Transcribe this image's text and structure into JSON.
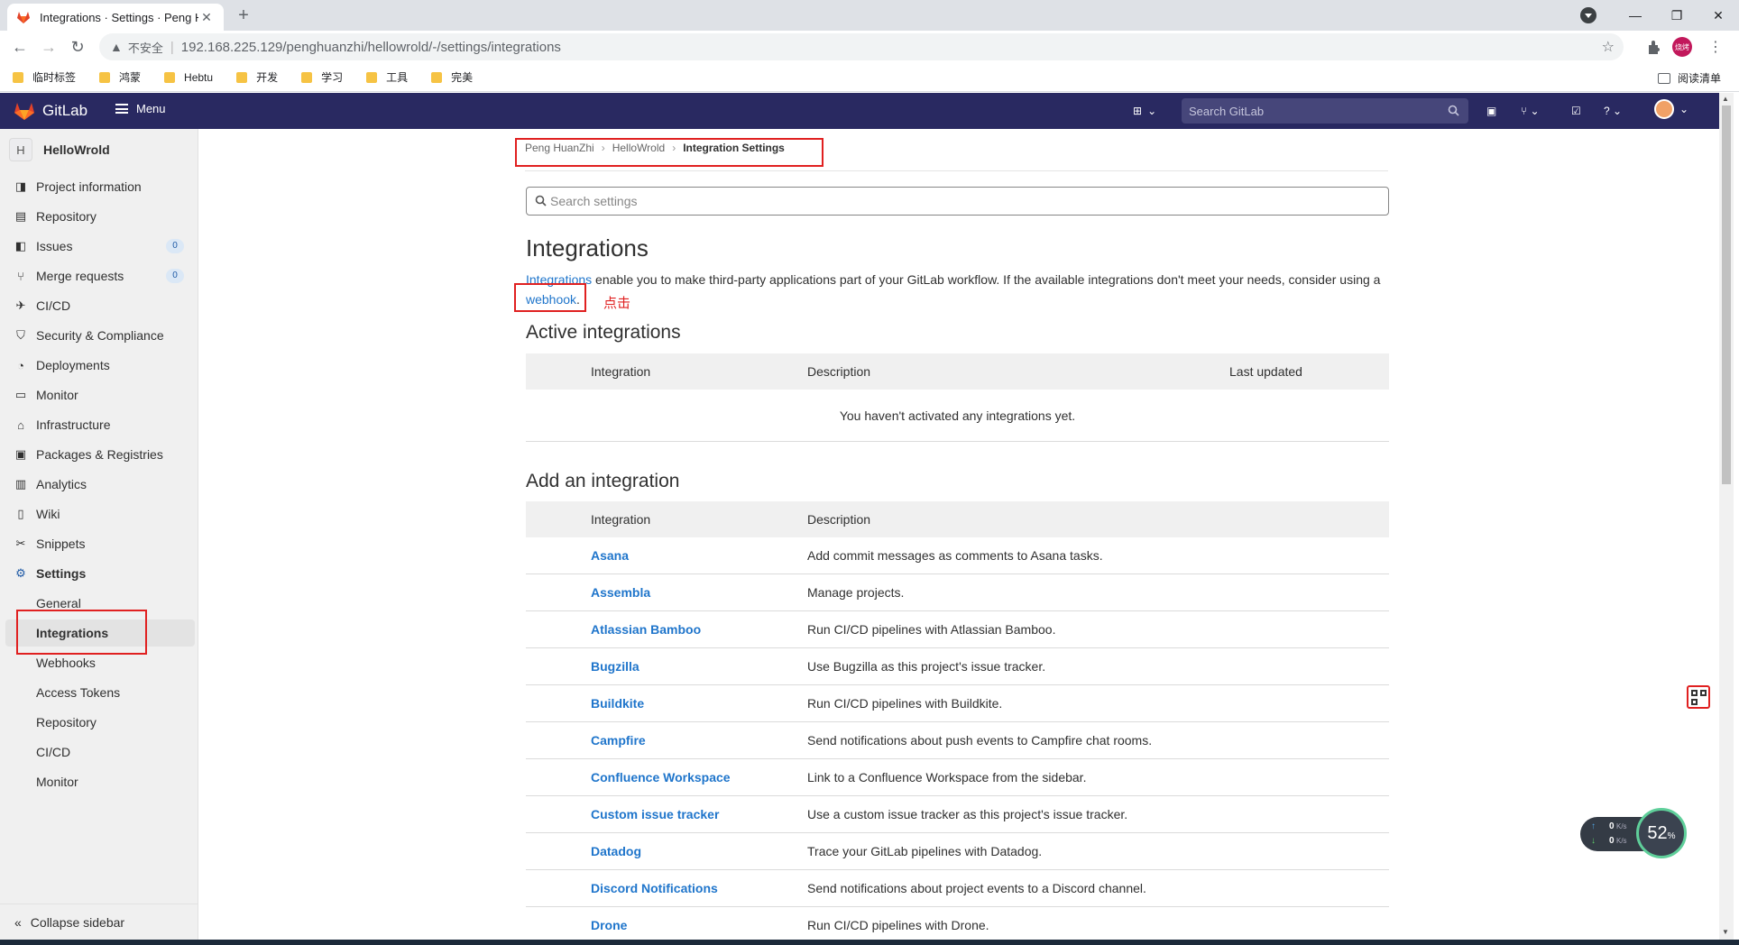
{
  "browser": {
    "tab_title": "Integrations · Settings · Peng H",
    "insecure_label": "不安全",
    "url": "192.168.225.129/penghuanzhi/hellowrold/-/settings/integrations",
    "profile_label": "烧烤",
    "bookmarks": [
      "临时标签",
      "鸿蒙",
      "Hebtu",
      "开发",
      "学习",
      "工具",
      "完美"
    ],
    "reading_list": "阅读清单"
  },
  "header": {
    "brand": "GitLab",
    "menu_label": "Menu",
    "search_placeholder": "Search GitLab"
  },
  "sidebar": {
    "project_initial": "H",
    "project_name": "HelloWrold",
    "items": [
      {
        "label": "Project information",
        "icon": "project-icon"
      },
      {
        "label": "Repository",
        "icon": "document-icon"
      },
      {
        "label": "Issues",
        "icon": "issues-icon",
        "badge": "0"
      },
      {
        "label": "Merge requests",
        "icon": "merge-request-icon",
        "badge": "0"
      },
      {
        "label": "CI/CD",
        "icon": "rocket-icon"
      },
      {
        "label": "Security & Compliance",
        "icon": "shield-icon"
      },
      {
        "label": "Deployments",
        "icon": "deployments-icon"
      },
      {
        "label": "Monitor",
        "icon": "monitor-icon"
      },
      {
        "label": "Infrastructure",
        "icon": "cloud-icon"
      },
      {
        "label": "Packages & Registries",
        "icon": "package-icon"
      },
      {
        "label": "Analytics",
        "icon": "chart-icon"
      },
      {
        "label": "Wiki",
        "icon": "book-icon"
      },
      {
        "label": "Snippets",
        "icon": "snippet-icon"
      },
      {
        "label": "Settings",
        "icon": "gear-icon"
      }
    ],
    "settings_sub": [
      "General",
      "Integrations",
      "Webhooks",
      "Access Tokens",
      "Repository",
      "CI/CD",
      "Monitor"
    ],
    "collapse_label": "Collapse sidebar"
  },
  "breadcrumb": [
    "Peng HuanZhi",
    "HelloWrold",
    "Integration Settings"
  ],
  "search_settings_placeholder": "Search settings",
  "page_title": "Integrations",
  "intro": {
    "link1": "Integrations",
    "text": " enable you to make third-party applications part of your GitLab workflow. If the available integrations don't meet your needs, consider using a ",
    "link2": "webhook",
    "end": "."
  },
  "click_note": "点击",
  "active": {
    "title": "Active integrations",
    "columns": [
      "Integration",
      "Description",
      "Last updated"
    ],
    "empty": "You haven't activated any integrations yet."
  },
  "add": {
    "title": "Add an integration",
    "columns": [
      "Integration",
      "Description"
    ],
    "rows": [
      {
        "name": "Asana",
        "desc": "Add commit messages as comments to Asana tasks."
      },
      {
        "name": "Assembla",
        "desc": "Manage projects."
      },
      {
        "name": "Atlassian Bamboo",
        "desc": "Run CI/CD pipelines with Atlassian Bamboo."
      },
      {
        "name": "Bugzilla",
        "desc": "Use Bugzilla as this project's issue tracker."
      },
      {
        "name": "Buildkite",
        "desc": "Run CI/CD pipelines with Buildkite."
      },
      {
        "name": "Campfire",
        "desc": "Send notifications about push events to Campfire chat rooms."
      },
      {
        "name": "Confluence Workspace",
        "desc": "Link to a Confluence Workspace from the sidebar."
      },
      {
        "name": "Custom issue tracker",
        "desc": "Use a custom issue tracker as this project's issue tracker."
      },
      {
        "name": "Datadog",
        "desc": "Trace your GitLab pipelines with Datadog."
      },
      {
        "name": "Discord Notifications",
        "desc": "Send notifications about project events to a Discord channel."
      },
      {
        "name": "Drone",
        "desc": "Run CI/CD pipelines with Drone."
      }
    ]
  },
  "net_widget": {
    "up": "0",
    "down": "0",
    "unit": "K/s",
    "percent": "52",
    "percent_sign": "%"
  },
  "colors": {
    "header": "#292961",
    "link": "#1f75cb",
    "annotation": "#e02020"
  }
}
